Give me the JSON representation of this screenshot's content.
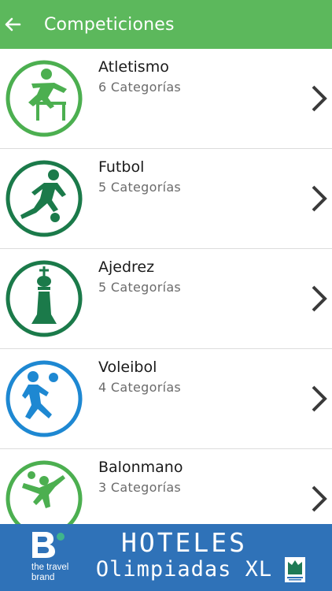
{
  "appbar": {
    "title": "Competiciones",
    "color": "#5cb85c",
    "back_icon": "arrow-left-icon"
  },
  "competitions": [
    {
      "name": "Atletismo",
      "count": "6 Categorías",
      "icon": "hurdles-icon",
      "color": "#4caf50"
    },
    {
      "name": "Futbol",
      "count": "5 Categorías",
      "icon": "football-player-icon",
      "color": "#1b7a4a"
    },
    {
      "name": "Ajedrez",
      "count": "5 Categorías",
      "icon": "chess-king-icon",
      "color": "#1b7a4a"
    },
    {
      "name": "Voleibol",
      "count": "4 Categorías",
      "icon": "volleyball-player-icon",
      "color": "#1e88d2"
    },
    {
      "name": "Balonmano",
      "count": "3 Categorías",
      "icon": "handball-player-icon",
      "color": "#4caf50"
    }
  ],
  "banner": {
    "line1": "HOTELES",
    "line2": "Olimpiadas XL",
    "brand_text": "the travel brand",
    "color": "#2f72b8"
  }
}
